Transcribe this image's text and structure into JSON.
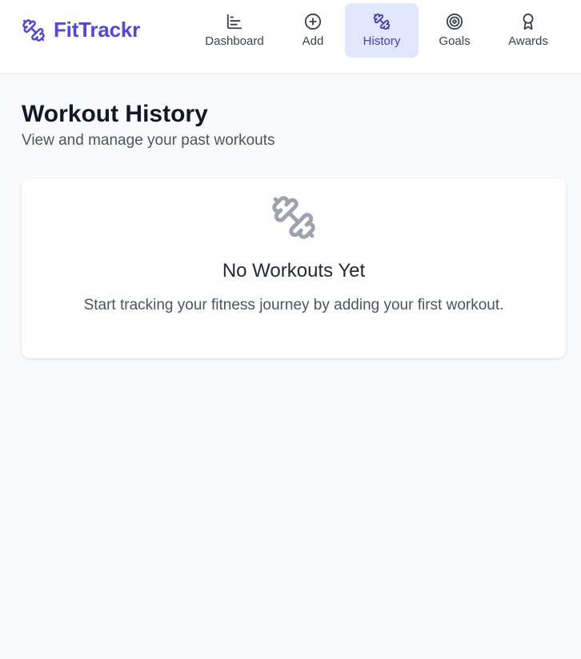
{
  "app": {
    "name": "FitTrackr",
    "brand_color": "#4f46e5",
    "logo_icon": "dumbbell-icon"
  },
  "nav": {
    "items": [
      {
        "label": "Dashboard",
        "icon": "bar-chart-icon",
        "active": false
      },
      {
        "label": "Add",
        "icon": "plus-circle-icon",
        "active": false
      },
      {
        "label": "History",
        "icon": "dumbbell-icon",
        "active": true
      },
      {
        "label": "Goals",
        "icon": "target-icon",
        "active": false
      },
      {
        "label": "Awards",
        "icon": "award-icon",
        "active": false
      }
    ],
    "active_bg_color": "#e0e7ff"
  },
  "page": {
    "title": "Workout History",
    "subtitle": "View and manage your past workouts"
  },
  "empty_state": {
    "icon": "dumbbell-icon",
    "title": "No Workouts Yet",
    "message": "Start tracking your fitness journey by adding your first workout."
  }
}
